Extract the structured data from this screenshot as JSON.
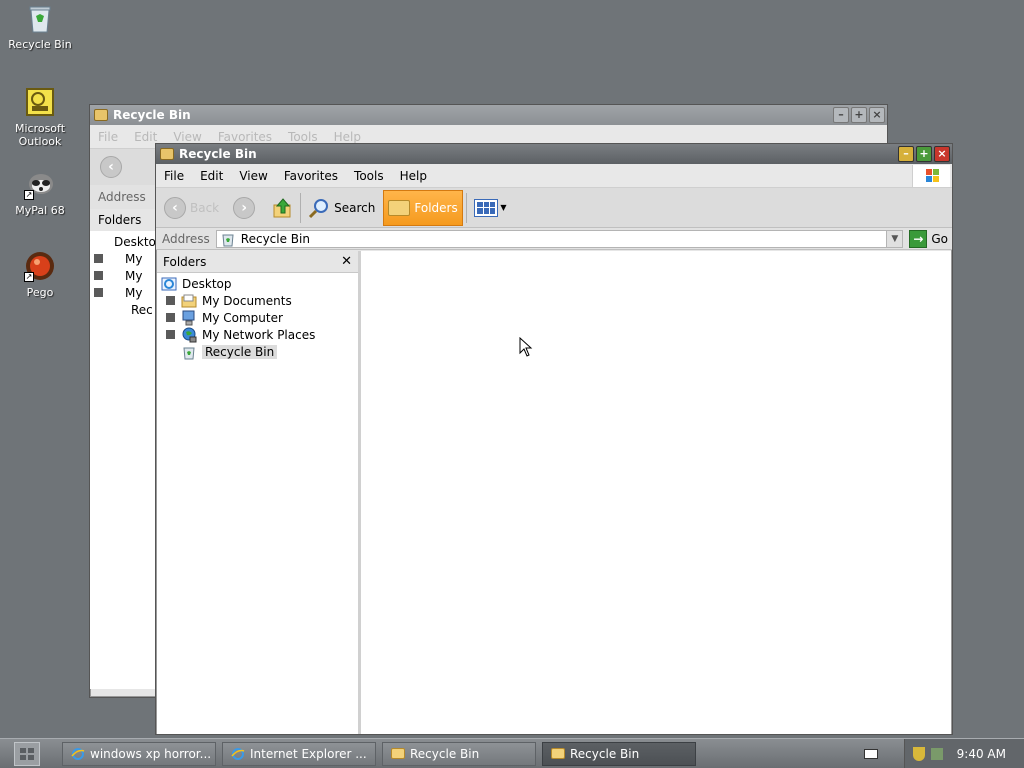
{
  "desktop": {
    "icons": [
      {
        "label": "Recycle Bin"
      },
      {
        "label": "Microsoft Outlook"
      },
      {
        "label": "MyPal 68"
      },
      {
        "label": "Pego"
      }
    ]
  },
  "back_window": {
    "title": "Recycle Bin",
    "menu": [
      "File",
      "Edit",
      "View",
      "Favorites",
      "Tools",
      "Help"
    ],
    "address_label": "Address",
    "folders_label": "Folders",
    "tree": [
      "Deskto",
      "My",
      "My",
      "My",
      "Rec"
    ]
  },
  "front_window": {
    "title": "Recycle Bin",
    "menu": {
      "file": "File",
      "edit": "Edit",
      "view": "View",
      "favorites": "Favorites",
      "tools": "Tools",
      "help": "Help"
    },
    "toolbar": {
      "back": "Back",
      "search": "Search",
      "folders": "Folders"
    },
    "address": {
      "label": "Address",
      "value": "Recycle Bin",
      "go": "Go"
    },
    "folders_pane": {
      "title": "Folders",
      "close": "✕",
      "tree": {
        "desktop": "Desktop",
        "my_documents": "My Documents",
        "my_computer": "My Computer",
        "my_network_places": "My Network Places",
        "recycle_bin": "Recycle Bin"
      }
    }
  },
  "taskbar": {
    "tasks": [
      {
        "label": "windows xp horror..."
      },
      {
        "label": "Internet Explorer ..."
      },
      {
        "label": "Recycle Bin"
      },
      {
        "label": "Recycle Bin"
      }
    ],
    "clock": "9:40 AM"
  },
  "colors": {
    "desktop": "#6f7478",
    "folders_active": "#f59a1e",
    "close_button": "#c8362c",
    "maximize_button": "#4a9a3a",
    "minimize_button": "#d6b03a"
  }
}
